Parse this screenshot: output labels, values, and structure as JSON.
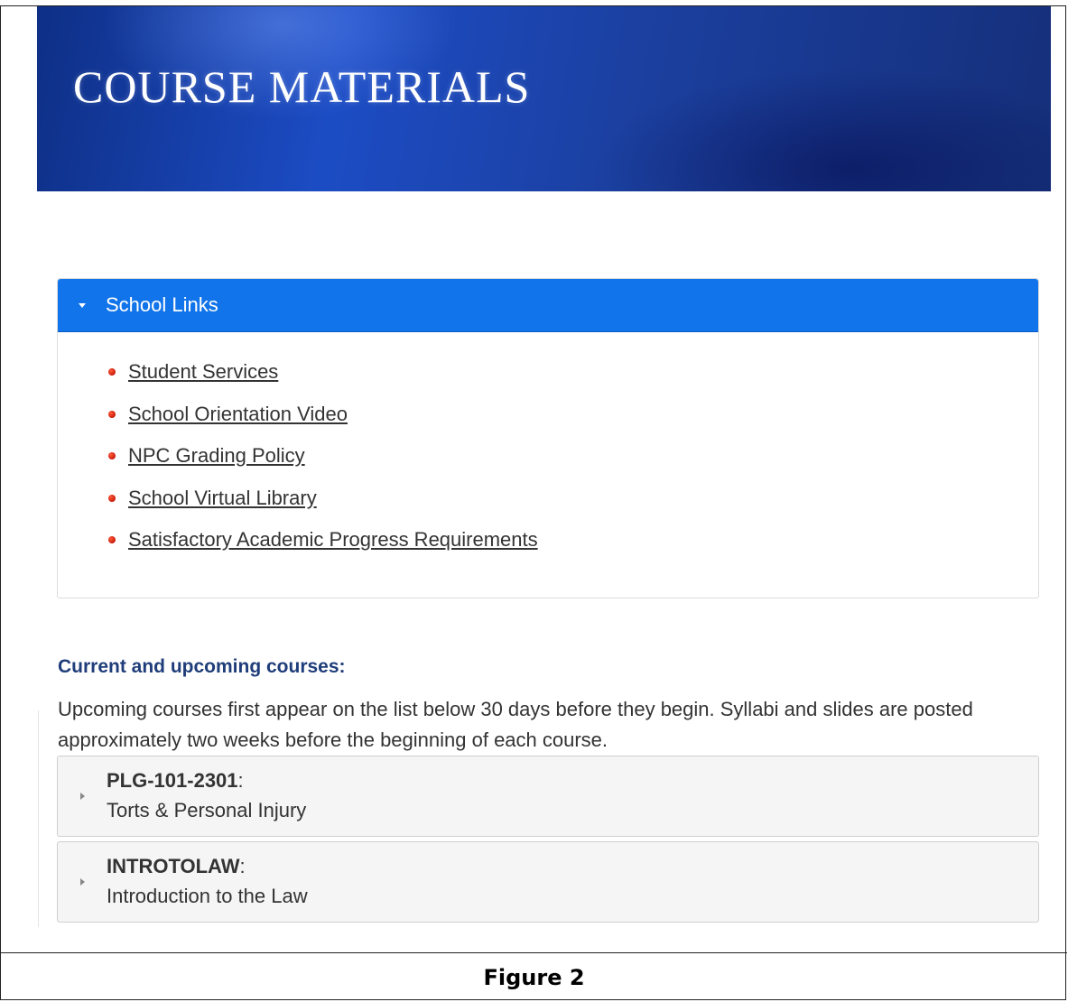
{
  "banner": {
    "title": "COURSE MATERIALS"
  },
  "school_links": {
    "title": "School Links",
    "expanded": true,
    "items": [
      {
        "label": "Student Services"
      },
      {
        "label": "School Orientation Video"
      },
      {
        "label": "NPC Grading Policy"
      },
      {
        "label": "School Virtual Library"
      },
      {
        "label": "Satisfactory Academic Progress Requirements"
      }
    ]
  },
  "courses": {
    "heading": "Current and upcoming courses:",
    "intro": "Upcoming courses first appear on the list below 30 days before they begin. Syllabi and slides are posted approximately two weeks before the beginning of each course.",
    "items": [
      {
        "code": "PLG-101-2301",
        "separator": ":",
        "name": "Torts & Personal Injury"
      },
      {
        "code": "INTROTOLAW",
        "separator": ":",
        "name": "Introduction to the Law"
      }
    ]
  },
  "caption": "Figure 2",
  "colors": {
    "accent": "#1174ea",
    "heading": "#1f3d7a",
    "bullet": "#d9230f",
    "banner": "#1c4cc4"
  }
}
